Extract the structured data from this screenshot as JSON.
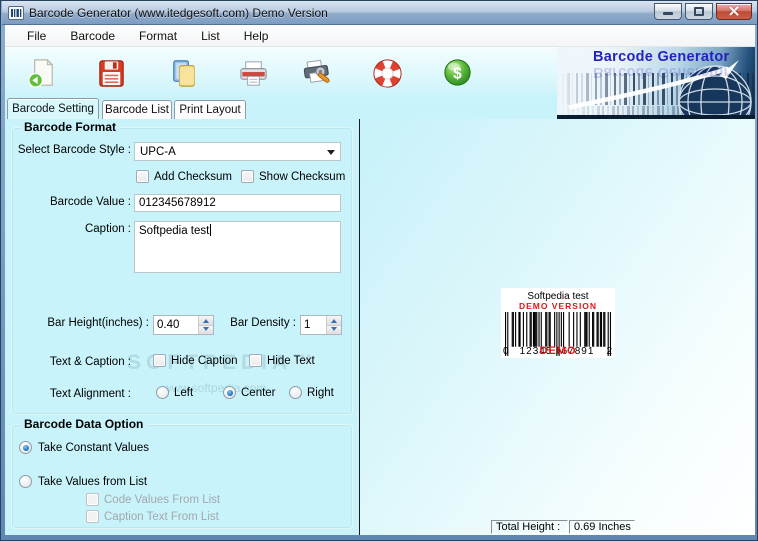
{
  "window": {
    "title": "Barcode Generator (www.itedgesoft.com) Demo Version"
  },
  "menu_bar": {
    "items": [
      "File",
      "Barcode",
      "Format",
      "List",
      "Help"
    ]
  },
  "toolbar": {
    "buttons": [
      "new-document",
      "save",
      "copy",
      "print",
      "print-setup",
      "help",
      "purchase"
    ]
  },
  "logo": {
    "title": "Barcode Generator"
  },
  "tabs": {
    "items": [
      {
        "label": "Barcode Setting",
        "active": true
      },
      {
        "label": "Barcode List",
        "active": false
      },
      {
        "label": "Print Layout",
        "active": false
      }
    ]
  },
  "barcode_format": {
    "group_title": "Barcode Format",
    "select_style_label": "Select Barcode Style :",
    "style_value": "UPC-A",
    "add_checksum_label": "Add Checksum",
    "add_checksum_checked": false,
    "show_checksum_label": "Show Checksum",
    "show_checksum_checked": false,
    "barcode_value_label": "Barcode Value :",
    "barcode_value": "012345678912",
    "caption_label": "Caption :",
    "caption_value": "Softpedia test",
    "bar_height_label": "Bar Height(inches) :",
    "bar_height_value": "0.40",
    "bar_density_label": "Bar Density :",
    "bar_density_value": "1",
    "text_caption_label": "Text & Caption :",
    "hide_caption_label": "Hide Caption",
    "hide_caption_checked": false,
    "hide_text_label": "Hide Text",
    "hide_text_checked": false,
    "text_alignment_label": "Text Alignment :",
    "alignment_options": [
      "Left",
      "Center",
      "Right"
    ],
    "alignment_selected": "Center"
  },
  "barcode_data_option": {
    "group_title": "Barcode Data Option",
    "options": [
      "Take Constant Values",
      "Take Values from List"
    ],
    "selected_option": "Take Constant Values",
    "code_values_label": "Code Values From List",
    "code_values_checked": false,
    "caption_text_label": "Caption Text From List",
    "caption_text_checked": false
  },
  "preview": {
    "caption": "Softpedia test",
    "demo_banner": "DEMO VERSION",
    "demo_overlay": "DEMO",
    "digit_groups": [
      "0",
      "12345",
      "67891",
      "2"
    ]
  },
  "status_bar": {
    "total_height_label": "Total Height :",
    "total_height_value": "0.69 Inches"
  },
  "watermark": {
    "line1": "SOFTPEDIA™",
    "line2": "www.softpedia.com"
  },
  "colors": {
    "main_background": "#C9F3FA",
    "logo_title_blue": "#2323BC",
    "demo_red": "#E01818",
    "titlebar_blue": "#8FADCE"
  }
}
